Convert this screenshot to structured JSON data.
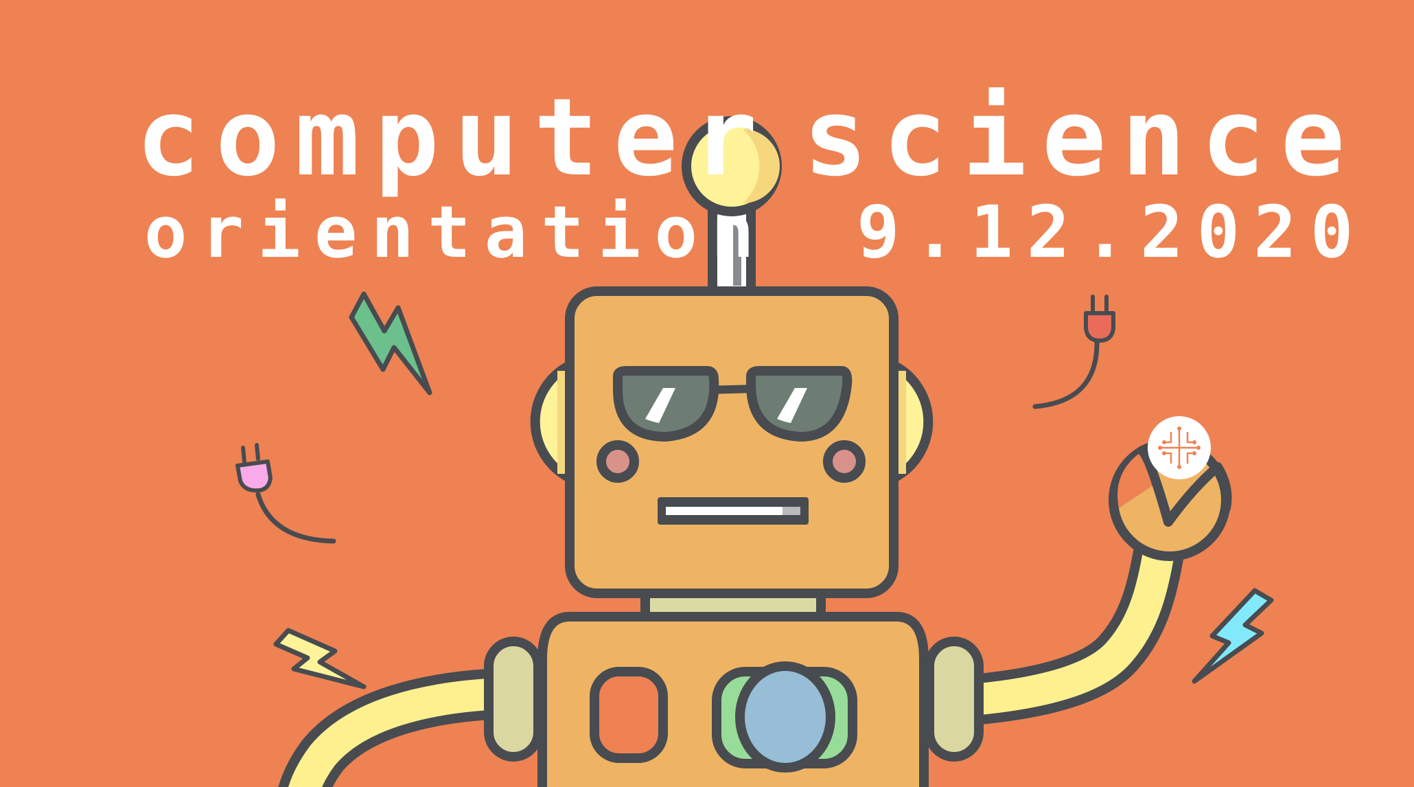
{
  "title": {
    "word1": "computer",
    "word2": "science",
    "subtitle": "orientation",
    "date": "9.12.2020"
  },
  "colors": {
    "background": "#EE8252",
    "outline": "#484B50",
    "robot_body": "#EEB464",
    "bulb": "#FEF399",
    "arm": "#FEF08F",
    "glasses": "#6D7D74",
    "cheek": "#D9928A",
    "eye_green": "#98DC99",
    "eye_blue": "#97BDD7",
    "hand_pad": "#DBD7A1",
    "neck": "#DBDBA1",
    "bolt_green": "#6BC08B",
    "bolt_yellow": "#FEF399",
    "bolt_cyan": "#81E9FA",
    "plug_pink": "#F9AAE8",
    "plug_red": "#E96B5A"
  },
  "icons": {
    "badge": "circuit-brain-icon"
  }
}
